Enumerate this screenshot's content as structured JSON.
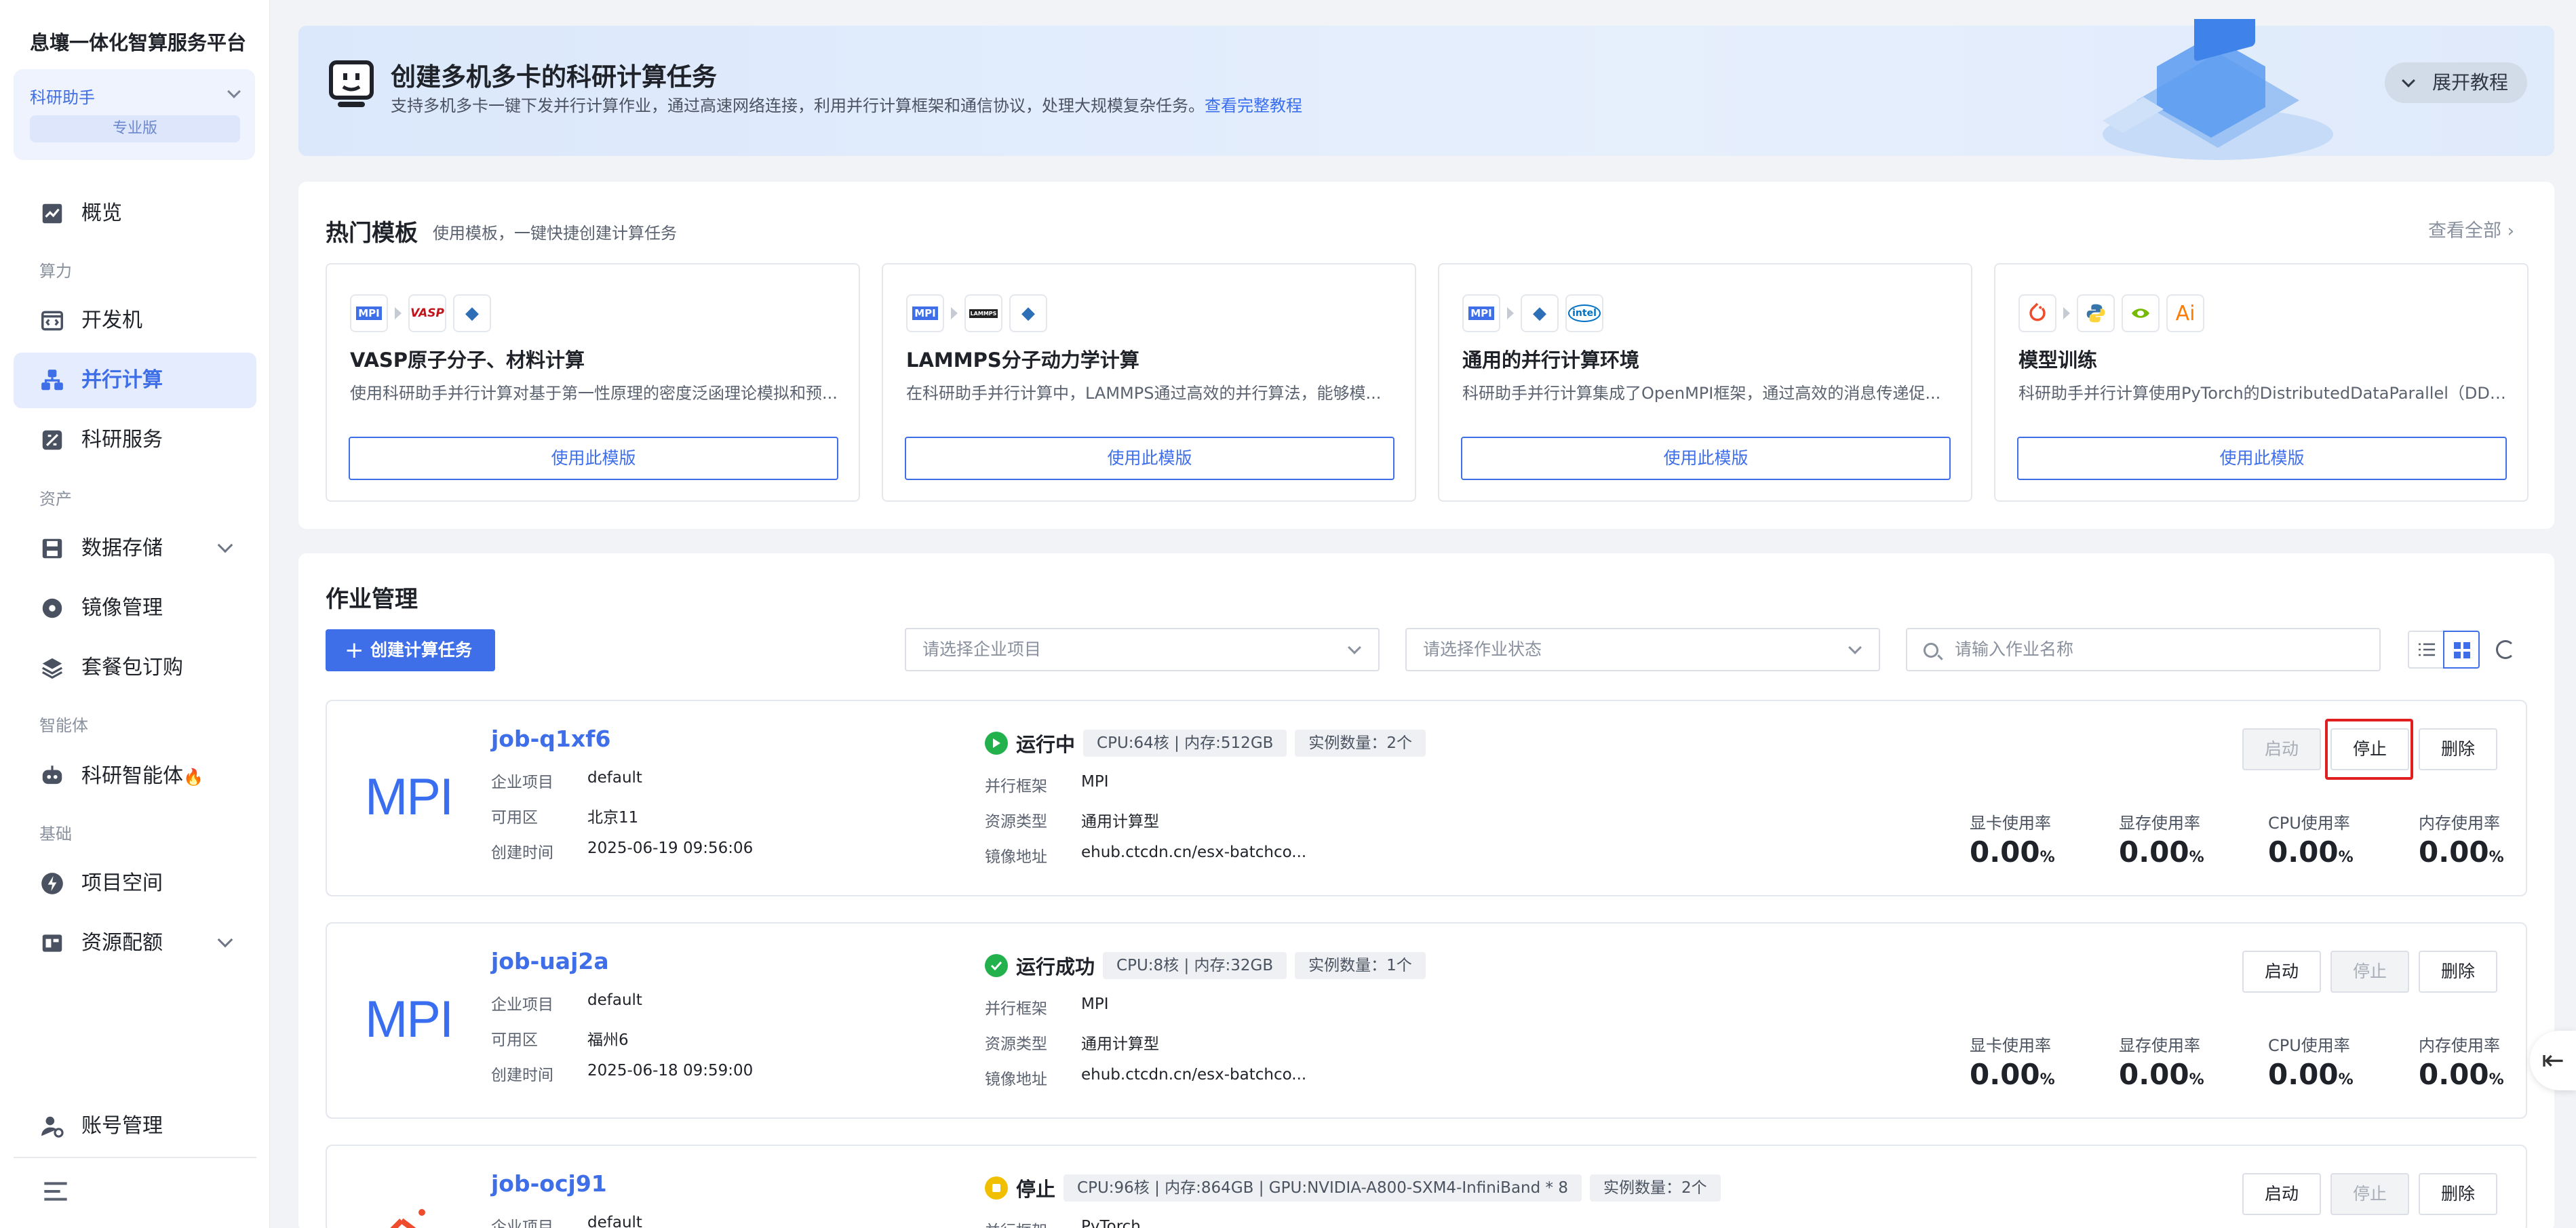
{
  "app": {
    "title": "息壤一体化智算服务平台"
  },
  "project_switcher": {
    "name": "科研助手",
    "edition": "专业版"
  },
  "sidebar": {
    "overview": "概览",
    "sec_compute": "算力",
    "devbox": "开发机",
    "parallel": "并行计算",
    "research": "科研服务",
    "sec_assets": "资产",
    "storage": "数据存储",
    "images": "镜像管理",
    "packages": "套餐包订购",
    "sec_agents": "智能体",
    "agent": "科研智能体",
    "agent_badge": "🔥",
    "sec_base": "基础",
    "workspace": "项目空间",
    "quota": "资源配额",
    "account": "账号管理"
  },
  "banner": {
    "title": "创建多机多卡的科研计算任务",
    "subtitle": "支持多机多卡一键下发并行计算作业，通过高速网络连接，利用并行计算框架和通信协议，处理大规模复杂任务。",
    "link": "查看完整教程",
    "expand": "展开教程"
  },
  "templates": {
    "title": "热门模板",
    "subtitle": "使用模板，一键快捷创建计算任务",
    "view_all": "查看全部",
    "use_label": "使用此模版",
    "items": [
      {
        "name": "VASP原子分子、材料计算",
        "desc": "使用科研助手并行计算对基于第一性原理的密度泛函理论模拟和预...",
        "icons": [
          "MPI",
          "VASP",
          "◆"
        ]
      },
      {
        "name": "LAMMPS分子动力学计算",
        "desc": "在科研助手并行计算中，LAMMPS通过高效的并行算法，能够模...",
        "icons": [
          "MPI",
          "LAMMPS",
          "◆"
        ]
      },
      {
        "name": "通用的并行计算环境",
        "desc": "科研助手并行计算集成了OpenMPI框架，通过高效的消息传递促...",
        "icons": [
          "MPI",
          "◆",
          "intel"
        ]
      },
      {
        "name": "模型训练",
        "desc": "科研助手并行计算使用PyTorch的DistributedDataParallel（DDP）...",
        "icons": [
          "torch",
          "python",
          "nvidia",
          "Ai"
        ]
      }
    ]
  },
  "jobs": {
    "title": "作业管理",
    "create_label": "创建计算任务",
    "filter_project_placeholder": "请选择企业项目",
    "filter_status_placeholder": "请选择作业状态",
    "search_placeholder": "请输入作业名称",
    "labels": {
      "project": "企业项目",
      "zone": "可用区",
      "created": "创建时间",
      "framework": "并行框架",
      "resource": "资源类型",
      "image": "镜像地址",
      "gpu_util": "显卡使用率",
      "vram_util": "显存使用率",
      "cpu_util": "CPU使用率",
      "mem_util": "内存使用率",
      "start": "启动",
      "stop": "停止",
      "delete": "删除"
    },
    "items": [
      {
        "name": "job-q1xf6",
        "logo": "MPI",
        "project": "default",
        "zone": "北京11",
        "created": "2025-06-19 09:56:06",
        "status": "运行中",
        "status_color": "#22b14c",
        "spec": "CPU:64核 | 内存:512GB",
        "instances": "实例数量：2个",
        "framework": "MPI",
        "resource": "通用计算型",
        "image": "ehub.ctcdn.cn/esx-batchco...",
        "gpu": "0.00",
        "vram": "0.00",
        "cpu": "0.00",
        "mem": "0.00",
        "unit": "%"
      },
      {
        "name": "job-uaj2a",
        "logo": "MPI",
        "project": "default",
        "zone": "福州6",
        "created": "2025-06-18 09:59:00",
        "status": "运行成功",
        "status_color": "#22b14c",
        "spec": "CPU:8核 | 内存:32GB",
        "instances": "实例数量：1个",
        "framework": "MPI",
        "resource": "通用计算型",
        "image": "ehub.ctcdn.cn/esx-batchco...",
        "gpu": "0.00",
        "vram": "0.00",
        "cpu": "0.00",
        "mem": "0.00",
        "unit": "%"
      },
      {
        "name": "job-ocj91",
        "logo": "",
        "project": "default",
        "zone": "",
        "created": "",
        "status": "停止",
        "status_color": "#f0c000",
        "spec": "CPU:96核 | 内存:864GB | GPU:NVIDIA-A800-SXM4-InfiniBand * 8",
        "instances": "实例数量：2个",
        "framework": "PyTorch",
        "resource": "",
        "image": ""
      }
    ]
  }
}
